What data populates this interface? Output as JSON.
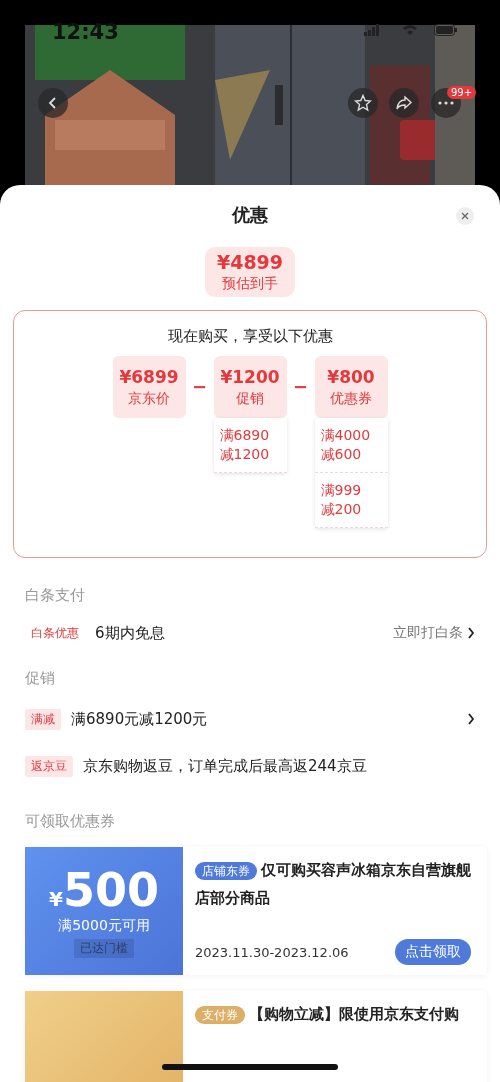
{
  "status_bar": {
    "time": "12:43"
  },
  "header": {
    "badge": "99+"
  },
  "sheet": {
    "title": "优惠"
  },
  "estimate": {
    "price": "¥4899",
    "label": "预估到手"
  },
  "breakdown": {
    "heading": "现在购买，享受以下优惠",
    "items": [
      {
        "price": "¥6899",
        "label": "京东价"
      },
      {
        "operator": "−",
        "price": "¥1200",
        "label": "促销",
        "details": [
          {
            "lines": [
              "满6890",
              "减1200"
            ]
          }
        ]
      },
      {
        "operator": "−",
        "price": "¥800",
        "label": "优惠券",
        "details": [
          {
            "lines": [
              "满4000",
              "减600"
            ]
          },
          {
            "lines": [
              "满999",
              "减200"
            ]
          }
        ]
      }
    ]
  },
  "baitiao": {
    "heading": "白条支付",
    "tag": "白条优惠",
    "text": "6期内免息",
    "action": "立即打白条"
  },
  "promotions": {
    "heading": "促销",
    "items": [
      {
        "tag": "满减",
        "text": "满6890元减1200元",
        "chevron": true
      },
      {
        "tag": "返京豆",
        "text": "京东购物返豆，订单完成后最高返244京豆",
        "chevron": false
      }
    ]
  },
  "coupons": {
    "heading": "可领取优惠券",
    "items": [
      {
        "kind": "store",
        "currency": "¥",
        "amount": "500",
        "condition": "满5000元可用",
        "status": "已达门槛",
        "tag": "店铺东券",
        "title": "仅可购买容声冰箱京东自营旗舰店部分商品",
        "dates": "2023.11.30-2023.12.06",
        "button": "点击领取"
      },
      {
        "kind": "payment",
        "tag": "支付券",
        "title": "【购物立减】限使用京东支付购"
      }
    ]
  }
}
